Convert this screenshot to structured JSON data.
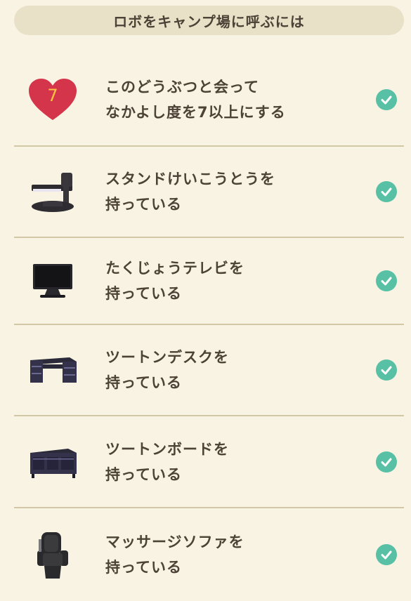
{
  "header": {
    "title": "ロボをキャンプ場に呼ぶには"
  },
  "conditions": [
    {
      "icon": "heart-icon",
      "badge": "7",
      "line1": "このどうぶつと会って",
      "line2": "なかよし度を7以上にする",
      "status": "check-icon"
    },
    {
      "icon": "desk-lamp-icon",
      "line1": "スタンドけいこうとうを",
      "line2": "持っている",
      "status": "check-icon"
    },
    {
      "icon": "tv-icon",
      "line1": "たくじょうテレビを",
      "line2": "持っている",
      "status": "check-icon"
    },
    {
      "icon": "desk-icon",
      "line1": "ツートンデスクを",
      "line2": "持っている",
      "status": "check-icon"
    },
    {
      "icon": "cabinet-icon",
      "line1": "ツートンボードを",
      "line2": "持っている",
      "status": "check-icon"
    },
    {
      "icon": "massage-chair-icon",
      "line1": "マッサージソファを",
      "line2": "持っている",
      "status": "check-icon"
    }
  ],
  "colors": {
    "background": "#f8f3e3",
    "header": "#e9e0c8",
    "divider": "#d4c7a7",
    "check": "#58c0a4",
    "heart": "#d4354a",
    "badge_text": "#f5c542"
  }
}
